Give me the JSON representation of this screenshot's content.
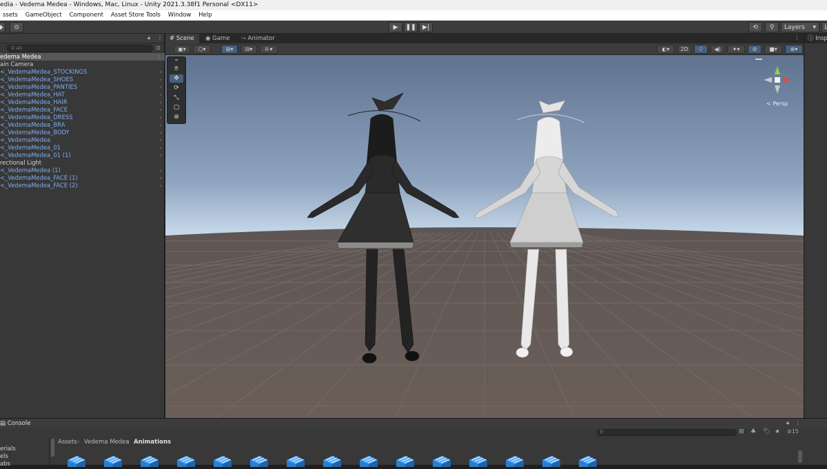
{
  "window": {
    "title": "edia - Vedema Medea - Windows, Mac, Linux - Unity 2021.3.38f1 Personal <DX11>"
  },
  "menu": [
    "ssets",
    "GameObject",
    "Component",
    "Asset Store Tools",
    "Window",
    "Help"
  ],
  "toolbar": {
    "layers_label": "Layers",
    "layout_label": "L"
  },
  "hierarchy": {
    "search_placeholder": "All",
    "items": [
      {
        "label": "edema Medea",
        "kind": "scene",
        "arrow": ""
      },
      {
        "label": "ain Camera",
        "kind": "object",
        "arrow": ""
      },
      {
        "label": "<_VedemaMedea_STOCKINGS",
        "kind": "prefab",
        "arrow": "›"
      },
      {
        "label": "<_VedemaMedea_SHOES",
        "kind": "prefab",
        "arrow": "›"
      },
      {
        "label": "<_VedemaMedea_PANTIES",
        "kind": "prefab",
        "arrow": "›"
      },
      {
        "label": "<_VedemaMedea_HAT",
        "kind": "prefab",
        "arrow": "›"
      },
      {
        "label": "<_VedemaMedea_HAIR",
        "kind": "prefab",
        "arrow": "›"
      },
      {
        "label": "<_VedemaMedea_FACE",
        "kind": "prefab",
        "arrow": "›"
      },
      {
        "label": "<_VedemaMedea_DRESS",
        "kind": "prefab",
        "arrow": "›"
      },
      {
        "label": "<_VedemaMedea_BRA",
        "kind": "prefab",
        "arrow": "›"
      },
      {
        "label": "<_VedemaMedea_BODY",
        "kind": "prefab",
        "arrow": "›"
      },
      {
        "label": "<_VedemaMedea",
        "kind": "prefab",
        "arrow": "›"
      },
      {
        "label": "<_VedemaMedea_01",
        "kind": "prefab",
        "arrow": "›"
      },
      {
        "label": "<_VedemaMedea_01 (1)",
        "kind": "prefab",
        "arrow": "›"
      },
      {
        "label": "rectional Light",
        "kind": "object",
        "arrow": ""
      },
      {
        "label": "<_VedemaMedea (1)",
        "kind": "prefab",
        "arrow": "›"
      },
      {
        "label": "<_VedemaMedea_FACE (1)",
        "kind": "prefab",
        "arrow": "›"
      },
      {
        "label": "<_VedemaMedea_FACE (2)",
        "kind": "prefab",
        "arrow": "›"
      }
    ]
  },
  "scene": {
    "tabs": [
      "Scene",
      "Game",
      "Animator"
    ],
    "toggle_2d": "2D",
    "gizmo_label": "< Persp"
  },
  "inspector": {
    "tab_label": "Insp"
  },
  "console": {
    "tab_label": "Console",
    "badge_count": "15"
  },
  "project": {
    "breadcrumb": [
      "Assets",
      "Vedema Medea",
      "Animations"
    ],
    "folders": [
      "erials",
      "els",
      "abs"
    ]
  },
  "colors": {
    "accent": "#46607e",
    "prefab_text": "#7eaef0",
    "sky_top": "#5f7391",
    "sky_horizon": "#d9ecf9",
    "ground": "#675c58"
  }
}
